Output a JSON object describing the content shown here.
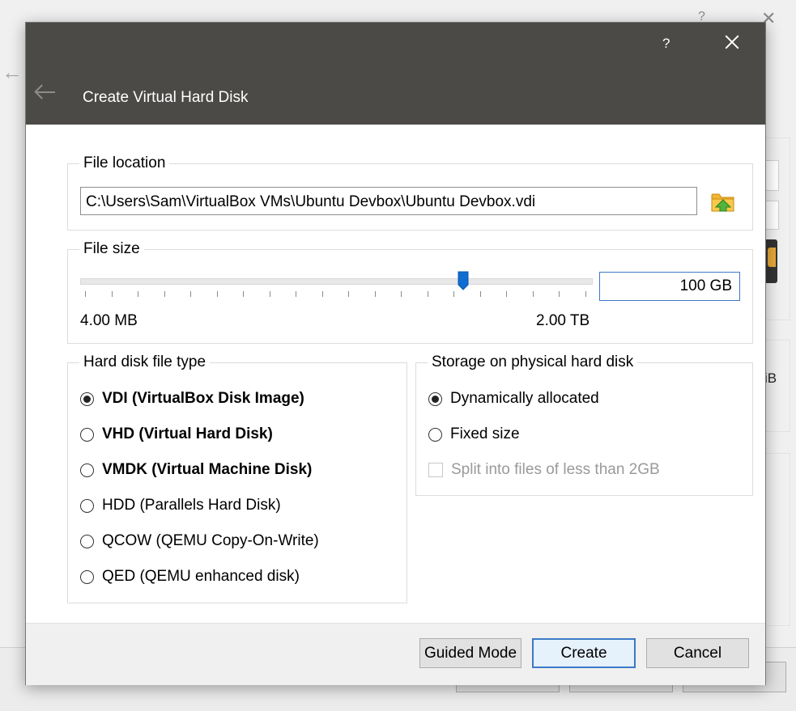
{
  "background": {
    "help_label": "?",
    "partial_text": "iB"
  },
  "dialog": {
    "title": "Create Virtual Hard Disk",
    "help_label": "?",
    "file_location": {
      "title": "File location",
      "path": "C:\\Users\\Sam\\VirtualBox VMs\\Ubuntu Devbox\\Ubuntu Devbox.vdi"
    },
    "file_size": {
      "title": "File size",
      "value": "100 GB",
      "min_label": "4.00 MB",
      "max_label": "2.00 TB",
      "slider_fraction": 0.75
    },
    "file_type": {
      "title": "Hard disk file type",
      "options": [
        {
          "label": "VDI (VirtualBox Disk Image)",
          "checked": true,
          "bold": true
        },
        {
          "label": "VHD (Virtual Hard Disk)",
          "checked": false,
          "bold": true
        },
        {
          "label": "VMDK (Virtual Machine Disk)",
          "checked": false,
          "bold": true
        },
        {
          "label": "HDD (Parallels Hard Disk)",
          "checked": false,
          "bold": false
        },
        {
          "label": "QCOW (QEMU Copy-On-Write)",
          "checked": false,
          "bold": false
        },
        {
          "label": "QED (QEMU enhanced disk)",
          "checked": false,
          "bold": false
        }
      ]
    },
    "storage": {
      "title": "Storage on physical hard disk",
      "dynamic_label": "Dynamically allocated",
      "fixed_label": "Fixed size",
      "split_label": "Split into files of less than 2GB"
    },
    "buttons": {
      "guided": "Guided Mode",
      "create": "Create",
      "cancel": "Cancel"
    }
  },
  "colors": {
    "titlebar": "#4b4a47",
    "accent": "#3b79c4",
    "slider_thumb": "#0f6cd1"
  }
}
